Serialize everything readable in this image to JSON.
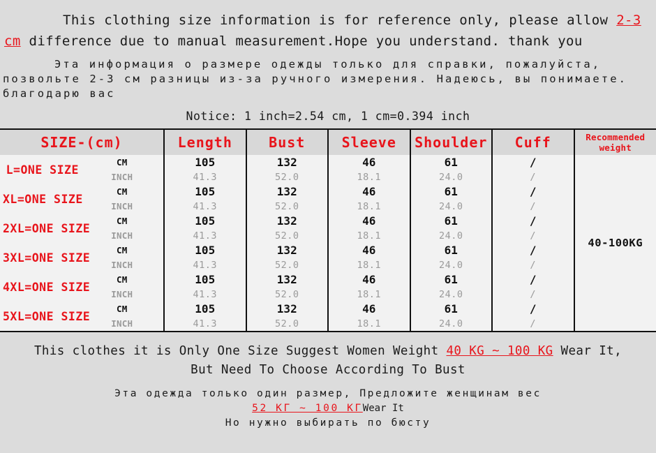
{
  "top_notice_en": {
    "part1": "This clothing size information is for reference only, please allow ",
    "highlight": "2-3 cm",
    "part2": " difference due to manual measurement.Hope you understand. thank you"
  },
  "top_notice_ru": {
    "line1": "Эта информация о размере одежды только для справк",
    "line2": "и, пожалуйста, позвольте 2-3 см разницы из-за ручного изме",
    "line3": "рения. Надеюсь, вы понимаете.",
    "line4": "благодарю вас"
  },
  "conversion_notice": "Notice: 1 inch=2.54 cm,  1 cm=0.394 inch",
  "table": {
    "headers": {
      "size": "SIZE-(cm)",
      "length": "Length",
      "bust": "Bust",
      "sleeve": "Sleeve",
      "shoulder": "Shoulder",
      "cuff": "Cuff",
      "weight_line1": "Recommended",
      "weight_line2": "weight"
    },
    "unit_cm": "CM",
    "unit_inch": "INCH",
    "recommended_weight": "40-100KG",
    "rows": [
      {
        "size": "L=ONE SIZE",
        "cm": {
          "length": "105",
          "bust": "132",
          "sleeve": "46",
          "shoulder": "61",
          "cuff": "/"
        },
        "inch": {
          "length": "41.3",
          "bust": "52.0",
          "sleeve": "18.1",
          "shoulder": "24.0",
          "cuff": "/"
        }
      },
      {
        "size": "XL=ONE SIZE",
        "cm": {
          "length": "105",
          "bust": "132",
          "sleeve": "46",
          "shoulder": "61",
          "cuff": "/"
        },
        "inch": {
          "length": "41.3",
          "bust": "52.0",
          "sleeve": "18.1",
          "shoulder": "24.0",
          "cuff": "/"
        }
      },
      {
        "size": "2XL=ONE SIZE",
        "cm": {
          "length": "105",
          "bust": "132",
          "sleeve": "46",
          "shoulder": "61",
          "cuff": "/"
        },
        "inch": {
          "length": "41.3",
          "bust": "52.0",
          "sleeve": "18.1",
          "shoulder": "24.0",
          "cuff": "/"
        }
      },
      {
        "size": "3XL=ONE SIZE",
        "cm": {
          "length": "105",
          "bust": "132",
          "sleeve": "46",
          "shoulder": "61",
          "cuff": "/"
        },
        "inch": {
          "length": "41.3",
          "bust": "52.0",
          "sleeve": "18.1",
          "shoulder": "24.0",
          "cuff": "/"
        }
      },
      {
        "size": "4XL=ONE SIZE",
        "cm": {
          "length": "105",
          "bust": "132",
          "sleeve": "46",
          "shoulder": "61",
          "cuff": "/"
        },
        "inch": {
          "length": "41.3",
          "bust": "52.0",
          "sleeve": "18.1",
          "shoulder": "24.0",
          "cuff": "/"
        }
      },
      {
        "size": "5XL=ONE SIZE",
        "cm": {
          "length": "105",
          "bust": "132",
          "sleeve": "46",
          "shoulder": "61",
          "cuff": "/"
        },
        "inch": {
          "length": "41.3",
          "bust": "52.0",
          "sleeve": "18.1",
          "shoulder": "24.0",
          "cuff": "/"
        }
      }
    ]
  },
  "bottom_en": {
    "part1": "This clothes it is Only One Size Suggest Women Weight ",
    "highlight": "40 KG ~ 100 KG",
    "part2": " Wear It,",
    "line2": "But Need To Choose According To Bust"
  },
  "bottom_ru": {
    "line1": "Эта одежда только один размер, Предложите женщинам вес",
    "highlight": "52 КГ ~ 100 КГ",
    "after_highlight": "Wear It",
    "line3": "Но нужно выбирать по бюсту"
  },
  "colors": {
    "accent_red": "#e8141b",
    "page_bg": "#dcdcdc",
    "table_bg": "#f2f2f2",
    "header_bg": "#d8d8d8",
    "inch_gray": "#9a9a9a"
  }
}
